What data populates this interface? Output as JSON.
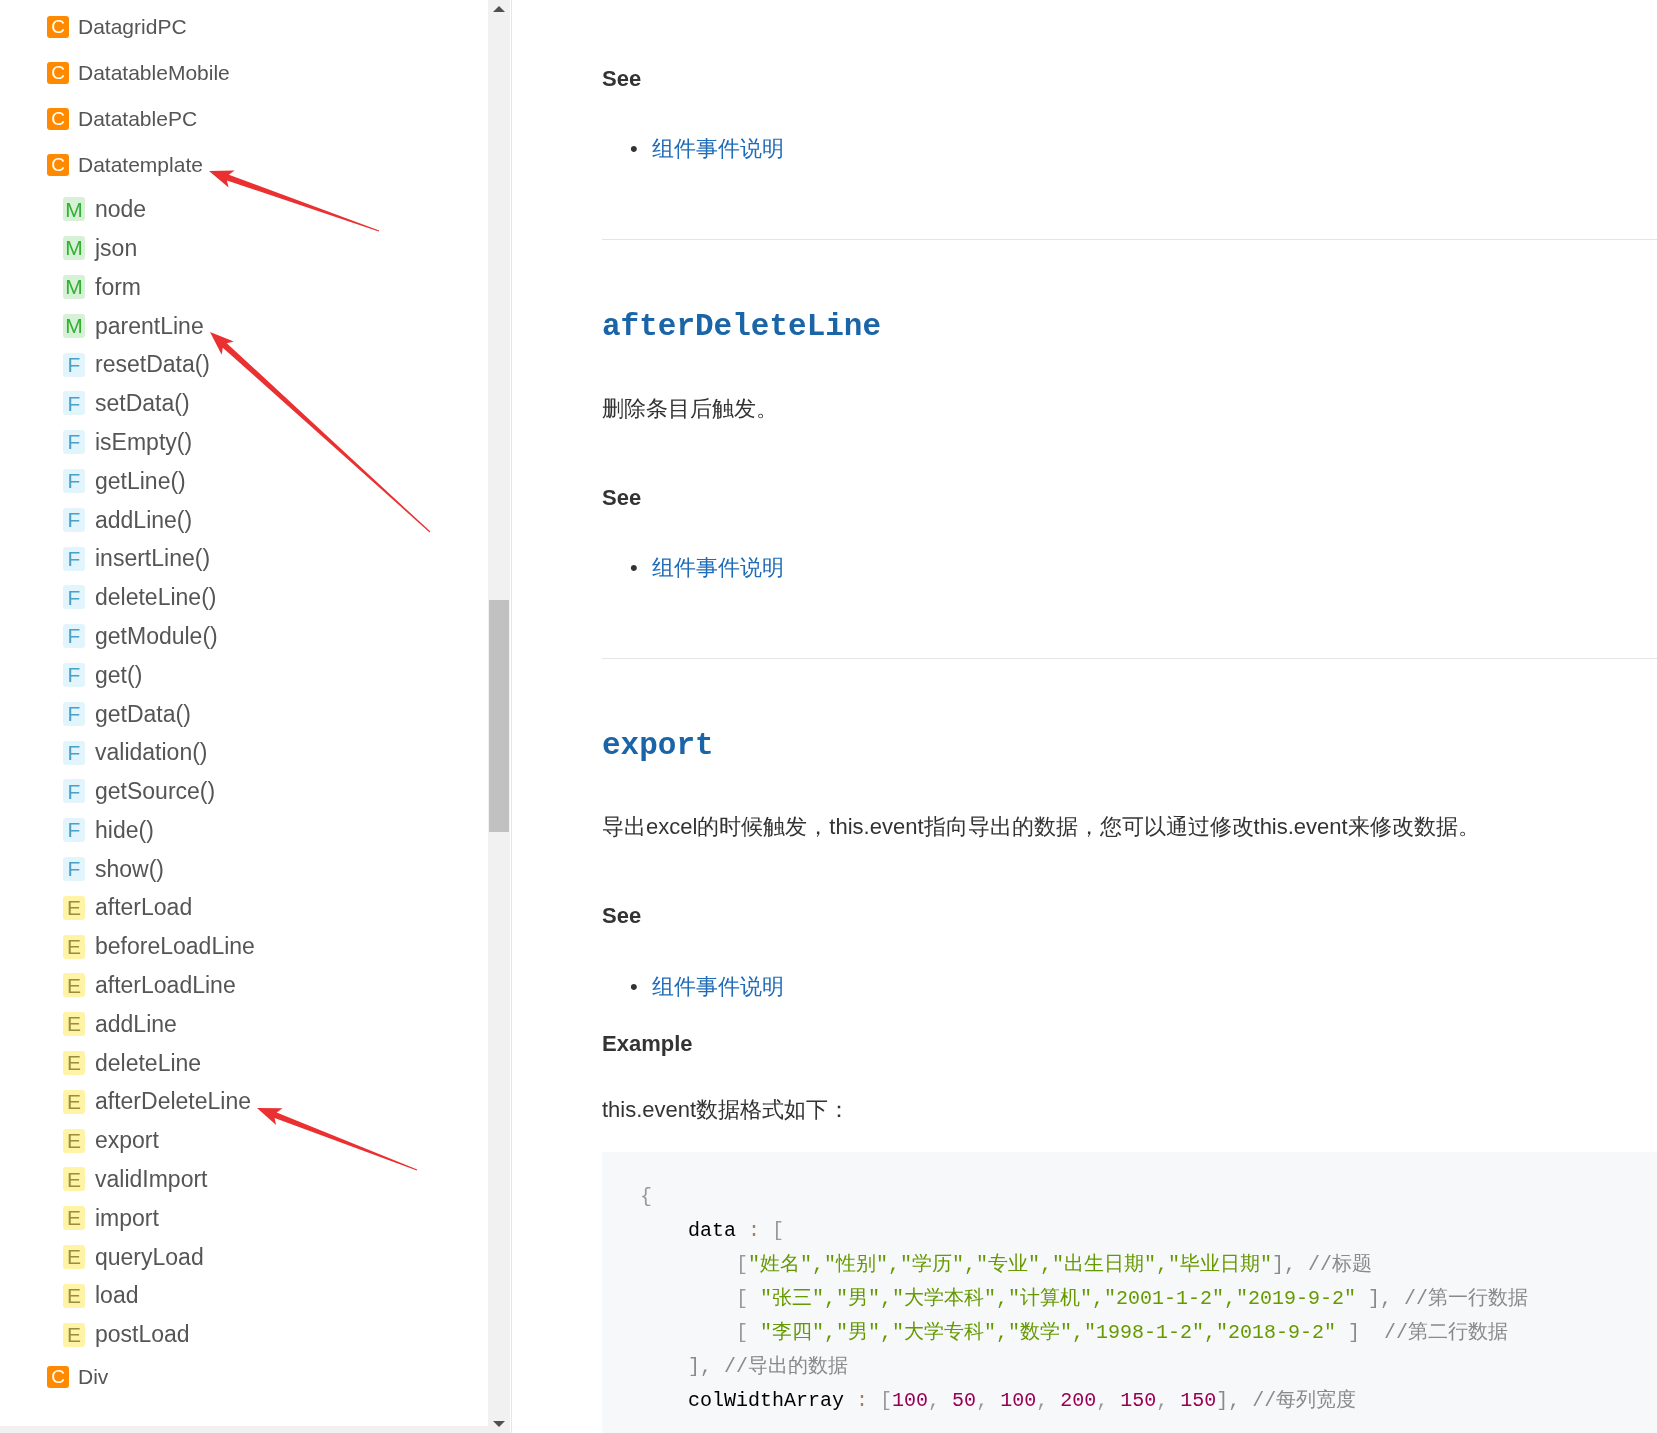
{
  "sidebar": {
    "items": [
      {
        "kind": "class",
        "badge": "C",
        "label": "DatagridPC",
        "arrow": false
      },
      {
        "kind": "class",
        "badge": "C",
        "label": "DatatableMobile",
        "arrow": false
      },
      {
        "kind": "class",
        "badge": "C",
        "label": "DatatablePC",
        "arrow": false
      },
      {
        "kind": "class",
        "badge": "C",
        "label": "Datatemplate",
        "arrow": true,
        "children": [
          {
            "kind": "member",
            "badge": "M",
            "label": "node",
            "arrow": false
          },
          {
            "kind": "member",
            "badge": "M",
            "label": "json",
            "arrow": false
          },
          {
            "kind": "member",
            "badge": "M",
            "label": "form",
            "arrow": false
          },
          {
            "kind": "member",
            "badge": "M",
            "label": "parentLine",
            "arrow": true
          },
          {
            "kind": "function",
            "badge": "F",
            "label": "resetData()",
            "arrow": false
          },
          {
            "kind": "function",
            "badge": "F",
            "label": "setData()",
            "arrow": false
          },
          {
            "kind": "function",
            "badge": "F",
            "label": "isEmpty()",
            "arrow": false
          },
          {
            "kind": "function",
            "badge": "F",
            "label": "getLine()",
            "arrow": false
          },
          {
            "kind": "function",
            "badge": "F",
            "label": "addLine()",
            "arrow": false
          },
          {
            "kind": "function",
            "badge": "F",
            "label": "insertLine()",
            "arrow": false
          },
          {
            "kind": "function",
            "badge": "F",
            "label": "deleteLine()",
            "arrow": false
          },
          {
            "kind": "function",
            "badge": "F",
            "label": "getModule()",
            "arrow": false
          },
          {
            "kind": "function",
            "badge": "F",
            "label": "get()",
            "arrow": false
          },
          {
            "kind": "function",
            "badge": "F",
            "label": "getData()",
            "arrow": false
          },
          {
            "kind": "function",
            "badge": "F",
            "label": "validation()",
            "arrow": false
          },
          {
            "kind": "function",
            "badge": "F",
            "label": "getSource()",
            "arrow": false
          },
          {
            "kind": "function",
            "badge": "F",
            "label": "hide()",
            "arrow": false
          },
          {
            "kind": "function",
            "badge": "F",
            "label": "show()",
            "arrow": false
          },
          {
            "kind": "event",
            "badge": "E",
            "label": "afterLoad",
            "arrow": false
          },
          {
            "kind": "event",
            "badge": "E",
            "label": "beforeLoadLine",
            "arrow": false
          },
          {
            "kind": "event",
            "badge": "E",
            "label": "afterLoadLine",
            "arrow": false
          },
          {
            "kind": "event",
            "badge": "E",
            "label": "addLine",
            "arrow": false
          },
          {
            "kind": "event",
            "badge": "E",
            "label": "deleteLine",
            "arrow": false
          },
          {
            "kind": "event",
            "badge": "E",
            "label": "afterDeleteLine",
            "arrow": true
          },
          {
            "kind": "event",
            "badge": "E",
            "label": "export",
            "arrow": false
          },
          {
            "kind": "event",
            "badge": "E",
            "label": "validImport",
            "arrow": false
          },
          {
            "kind": "event",
            "badge": "E",
            "label": "import",
            "arrow": false
          },
          {
            "kind": "event",
            "badge": "E",
            "label": "queryLoad",
            "arrow": false
          },
          {
            "kind": "event",
            "badge": "E",
            "label": "load",
            "arrow": false
          },
          {
            "kind": "event",
            "badge": "E",
            "label": "postLoad",
            "arrow": false
          }
        ]
      },
      {
        "kind": "class",
        "badge": "C",
        "label": "Div",
        "arrow": false
      }
    ]
  },
  "sections": [
    {
      "see": "See",
      "links": [
        {
          "bullet": "•",
          "label": "组件事件说明"
        }
      ]
    },
    {
      "title": "afterDeleteLine",
      "description": "删除条目后触发。",
      "see": "See",
      "links": [
        {
          "bullet": "•",
          "label": "组件事件说明"
        }
      ]
    },
    {
      "title": "export",
      "description": "导出excel的时候触发，this.event指向导出的数据，您可以通过修改this.event来修改数据。",
      "see": "See",
      "links": [
        {
          "bullet": "•",
          "label": "组件事件说明"
        }
      ],
      "example": {
        "heading": "Example",
        "intro": "this.event数据格式如下：",
        "code": [
          [
            {
              "kind": "punct",
              "text": "{"
            }
          ],
          [
            {
              "kind": "key",
              "text": "    data"
            },
            {
              "kind": "op",
              "text": " : "
            },
            {
              "kind": "punct",
              "text": "["
            }
          ],
          [
            {
              "kind": "punct",
              "text": "        ["
            },
            {
              "kind": "string",
              "text": "\"姓名\",\"性别\",\"学历\",\"专业\",\"出生日期\",\"毕业日期\""
            },
            {
              "kind": "comment",
              "text": "], //标题"
            }
          ],
          [
            {
              "kind": "punct",
              "text": "        [ "
            },
            {
              "kind": "string",
              "text": "\"张三\",\"男\",\"大学本科\",\"计算机\",\"2001-1-2\",\"2019-9-2\""
            },
            {
              "kind": "comment",
              "text": " ], //第一行数据"
            }
          ],
          [
            {
              "kind": "punct",
              "text": "        [ "
            },
            {
              "kind": "string",
              "text": "\"李四\",\"男\",\"大学专科\",\"数学\",\"1998-1-2\",\"2018-9-2\""
            },
            {
              "kind": "comment",
              "text": " ]  //第二行数据"
            }
          ],
          [
            {
              "kind": "comment",
              "text": "    ], //导出的数据"
            }
          ],
          [
            {
              "kind": "key",
              "text": "    colWidthArray"
            },
            {
              "kind": "op",
              "text": " : "
            },
            {
              "kind": "punct",
              "text": "["
            },
            {
              "kind": "number",
              "text": "100"
            },
            {
              "kind": "punct",
              "text": ", "
            },
            {
              "kind": "number",
              "text": "50"
            },
            {
              "kind": "punct",
              "text": ", "
            },
            {
              "kind": "number",
              "text": "100"
            },
            {
              "kind": "punct",
              "text": ", "
            },
            {
              "kind": "number",
              "text": "200"
            },
            {
              "kind": "punct",
              "text": ", "
            },
            {
              "kind": "number",
              "text": "150"
            },
            {
              "kind": "punct",
              "text": ", "
            },
            {
              "kind": "number",
              "text": "150"
            },
            {
              "kind": "comment",
              "text": "], //每列宽度"
            }
          ]
        ]
      }
    }
  ]
}
